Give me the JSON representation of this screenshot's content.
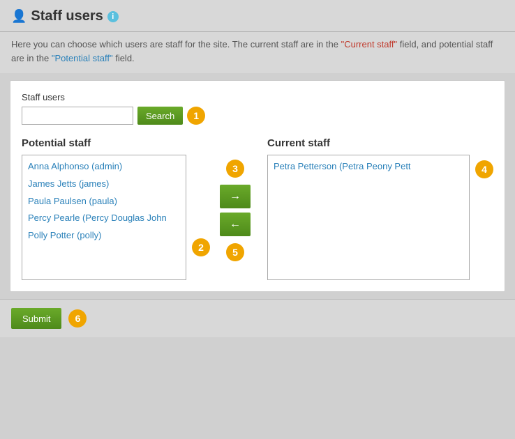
{
  "header": {
    "title": "Staff users",
    "info_icon_label": "i"
  },
  "description": {
    "text_before": "Here you can choose which users are staff for the site. The current staff are in the ",
    "quote_current": "\"Current staff\"",
    "text_middle": " field, and potential staff are in the ",
    "quote_potential": "\"Potential staff\"",
    "text_after": " field."
  },
  "form": {
    "staff_users_label": "Staff users",
    "search_placeholder": "",
    "search_button_label": "Search",
    "potential_staff_title": "Potential staff",
    "current_staff_title": "Current staff",
    "potential_staff_items": [
      "Anna Alphonso (admin)",
      "James Jetts (james)",
      "Paula Paulsen (paula)",
      "Percy Pearle (Percy Douglas John",
      "Polly Potter (polly)"
    ],
    "current_staff_items": [
      "Petra Petterson (Petra Peony Pett"
    ],
    "move_right_label": "→",
    "move_left_label": "←",
    "submit_label": "Submit"
  },
  "annotations": {
    "1": "1",
    "2": "2",
    "3": "3",
    "4": "4",
    "5": "5",
    "6": "6"
  },
  "icons": {
    "user_icon": "👤"
  }
}
